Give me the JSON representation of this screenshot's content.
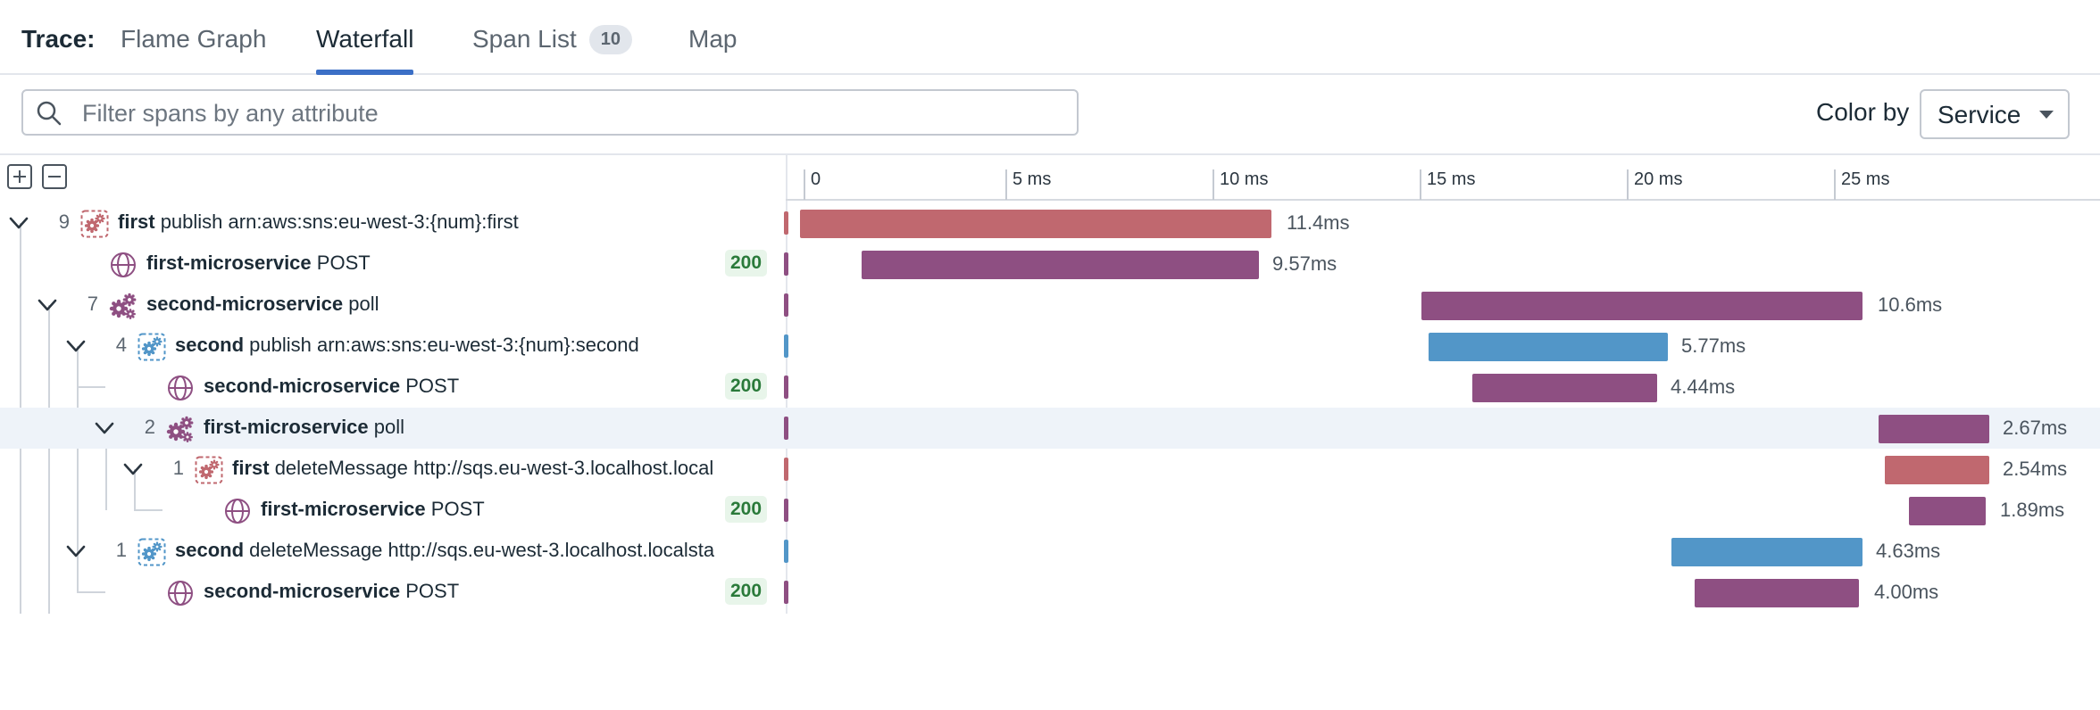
{
  "tabs": {
    "title": "Trace:",
    "items": [
      {
        "label": "Flame Graph",
        "active": false
      },
      {
        "label": "Waterfall",
        "active": true
      },
      {
        "label": "Span List",
        "badge": "10",
        "active": false
      },
      {
        "label": "Map",
        "active": false
      }
    ]
  },
  "filter": {
    "placeholder": "Filter spans by any attribute",
    "value": ""
  },
  "color_by": {
    "label": "Color by",
    "value": "Service"
  },
  "colors": {
    "first": "#c0686f",
    "microservice": "#8e4f82",
    "second": "#5296c8",
    "accent": "#3b6fc6",
    "status_text": "#2a7a3a"
  },
  "timeline": {
    "ticks": [
      "0",
      "5 ms",
      "10 ms",
      "15 ms",
      "20 ms",
      "25 ms"
    ]
  },
  "spans": [
    {
      "count": "9",
      "service": "first",
      "operation": "publish arn:aws:sns:eu-west-3:{num}:first",
      "status": "",
      "duration": "11.4ms",
      "icon": "sns-cog-icon",
      "color": "first",
      "expanded": true
    },
    {
      "count": "",
      "service": "first-microservice",
      "operation": "POST",
      "status": "200",
      "duration": "9.57ms",
      "icon": "globe-icon",
      "color": "microservice",
      "expanded": false
    },
    {
      "count": "7",
      "service": "second-microservice",
      "operation": "poll",
      "status": "",
      "duration": "10.6ms",
      "icon": "cogs-icon",
      "color": "microservice",
      "expanded": true
    },
    {
      "count": "4",
      "service": "second",
      "operation": "publish arn:aws:sns:eu-west-3:{num}:second",
      "status": "",
      "duration": "5.77ms",
      "icon": "sns-cog-icon",
      "color": "second",
      "expanded": true
    },
    {
      "count": "",
      "service": "second-microservice",
      "operation": "POST",
      "status": "200",
      "duration": "4.44ms",
      "icon": "globe-icon",
      "color": "microservice",
      "expanded": false
    },
    {
      "count": "2",
      "service": "first-microservice",
      "operation": "poll",
      "status": "",
      "duration": "2.67ms",
      "icon": "cogs-icon",
      "color": "microservice",
      "expanded": true,
      "highlighted": true
    },
    {
      "count": "1",
      "service": "first",
      "operation": "deleteMessage http://sqs.eu-west-3.localhost.local...",
      "status": "",
      "duration": "2.54ms",
      "icon": "sns-cog-icon",
      "color": "first",
      "expanded": true
    },
    {
      "count": "",
      "service": "first-microservice",
      "operation": "POST",
      "status": "200",
      "duration": "1.89ms",
      "icon": "globe-icon",
      "color": "microservice",
      "expanded": false
    },
    {
      "count": "1",
      "service": "second",
      "operation": "deleteMessage http://sqs.eu-west-3.localhost.localsta...",
      "status": "",
      "duration": "4.63ms",
      "icon": "sns-cog-icon",
      "color": "second",
      "expanded": true
    },
    {
      "count": "",
      "service": "second-microservice",
      "operation": "POST",
      "status": "200",
      "duration": "4.00ms",
      "icon": "globe-icon",
      "color": "microservice",
      "expanded": false
    }
  ]
}
